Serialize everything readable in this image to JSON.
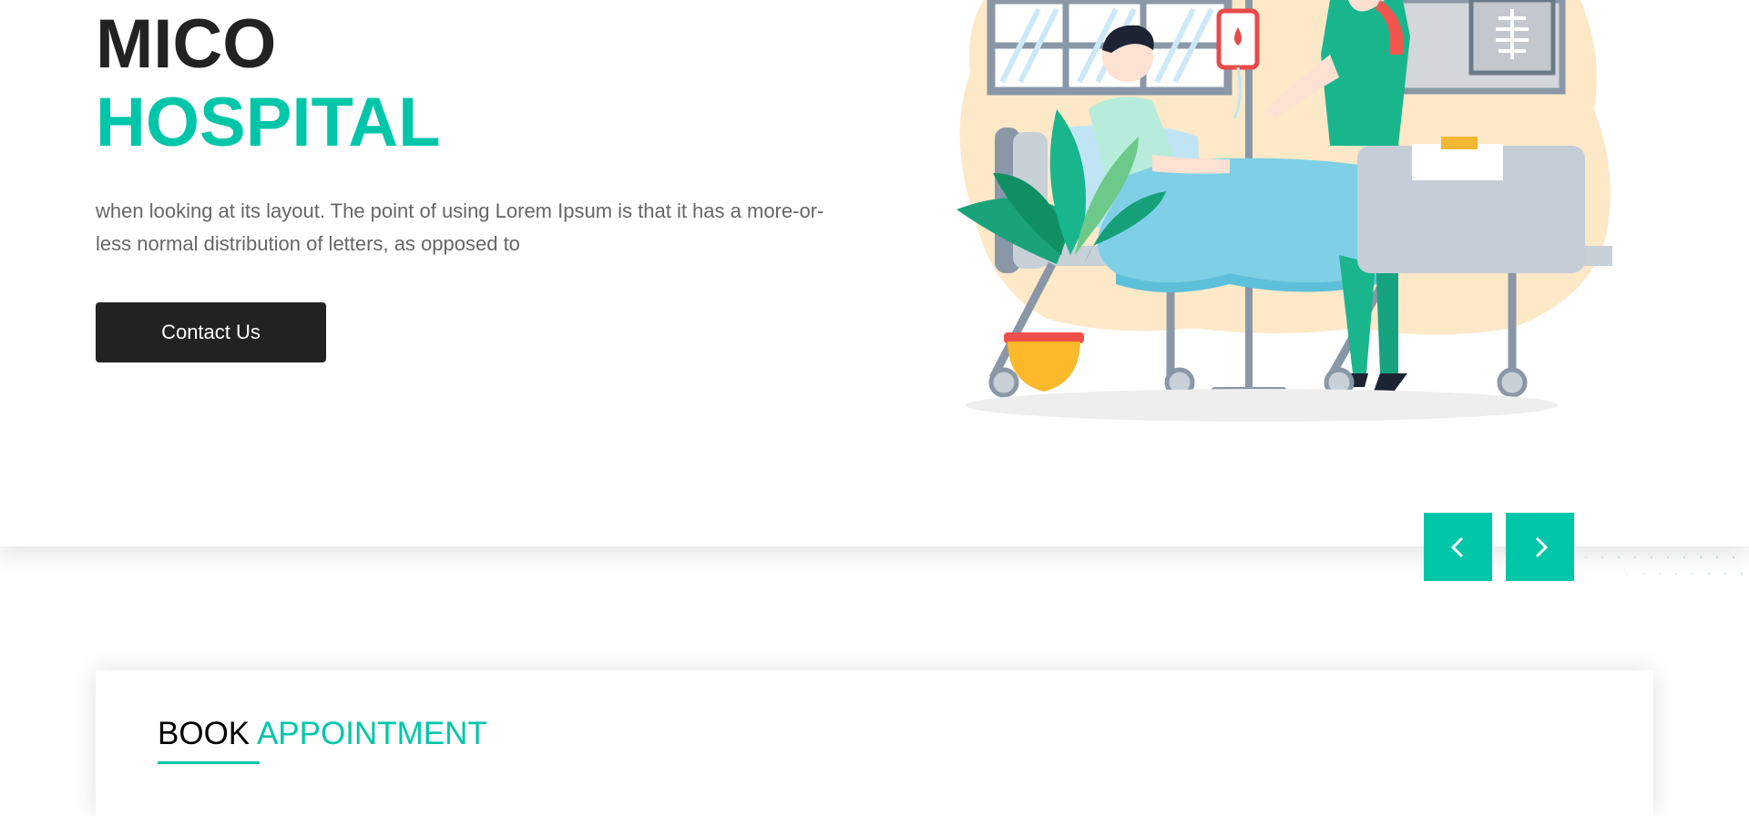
{
  "hero": {
    "title_line1": "MICO",
    "title_line2": "HOSPITAL",
    "description": "when looking at its layout. The point of using Lorem Ipsum is that it has a more-or-less normal distribution of letters, as opposed to",
    "contact_button": "Contact Us"
  },
  "carousel": {
    "prev_icon": "chevron-left-icon",
    "next_icon": "chevron-right-icon"
  },
  "booking": {
    "title_word1": "BOOK",
    "title_word2": "APPOINTMENT"
  },
  "colors": {
    "accent": "#00c6a9",
    "dark": "#222222",
    "text_muted": "#666666"
  }
}
